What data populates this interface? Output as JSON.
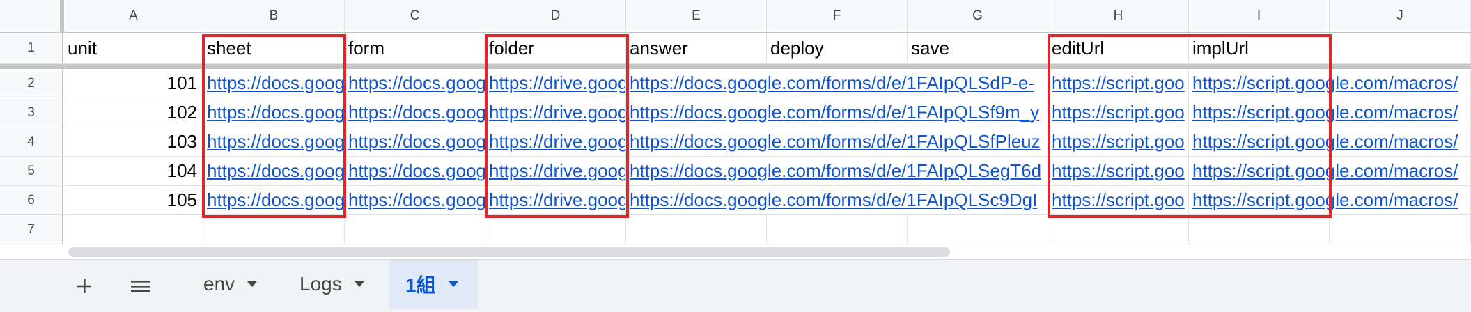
{
  "columns": [
    "A",
    "B",
    "C",
    "D",
    "E",
    "F",
    "G",
    "H",
    "I",
    "J"
  ],
  "rows": [
    "1",
    "2",
    "3",
    "4",
    "5",
    "6",
    "7"
  ],
  "headers": {
    "A": "unit",
    "B": "sheet",
    "C": "form",
    "D": "folder",
    "E": "answer",
    "F": "deploy",
    "G": "save",
    "H": "editUrl",
    "I": "implUrl",
    "J": ""
  },
  "data_rows": [
    {
      "unit": "101",
      "sheet": "https://docs.goog",
      "form": "https://docs.goog",
      "folder": "https://drive.goog",
      "answer": "https://docs.google.com/forms/d/e/1FAIpQLSdP-e-",
      "edit": "https://script.goo",
      "impl": "https://script.google.com/macros/"
    },
    {
      "unit": "102",
      "sheet": "https://docs.goog",
      "form": "https://docs.goog",
      "folder": "https://drive.goog",
      "answer": "https://docs.google.com/forms/d/e/1FAIpQLSf9m_y",
      "edit": "https://script.goo",
      "impl": "https://script.google.com/macros/"
    },
    {
      "unit": "103",
      "sheet": "https://docs.goog",
      "form": "https://docs.goog",
      "folder": "https://drive.goog",
      "answer": "https://docs.google.com/forms/d/e/1FAIpQLSfPleuz",
      "edit": "https://script.goo",
      "impl": "https://script.google.com/macros/"
    },
    {
      "unit": "104",
      "sheet": "https://docs.goog",
      "form": "https://docs.goog",
      "folder": "https://drive.goog",
      "answer": "https://docs.google.com/forms/d/e/1FAIpQLSegT6d",
      "edit": "https://script.goo",
      "impl": "https://script.google.com/macros/"
    },
    {
      "unit": "105",
      "sheet": "https://docs.goog",
      "form": "https://docs.goog",
      "folder": "https://drive.goog",
      "answer": "https://docs.google.com/forms/d/e/1FAIpQLSc9DgI",
      "edit": "https://script.goo",
      "impl": "https://script.google.com/macros/"
    }
  ],
  "tabs": [
    {
      "label": "env",
      "active": false
    },
    {
      "label": "Logs",
      "active": false
    },
    {
      "label": "1組",
      "active": true
    }
  ],
  "toolbar_icons": {
    "add": "plus-icon",
    "list": "menu-icon"
  },
  "colors": {
    "link": "#1155cc",
    "highlight": "#e3242b",
    "active_tab_bg": "#e1e9f7",
    "active_tab_text": "#0b57d0"
  }
}
